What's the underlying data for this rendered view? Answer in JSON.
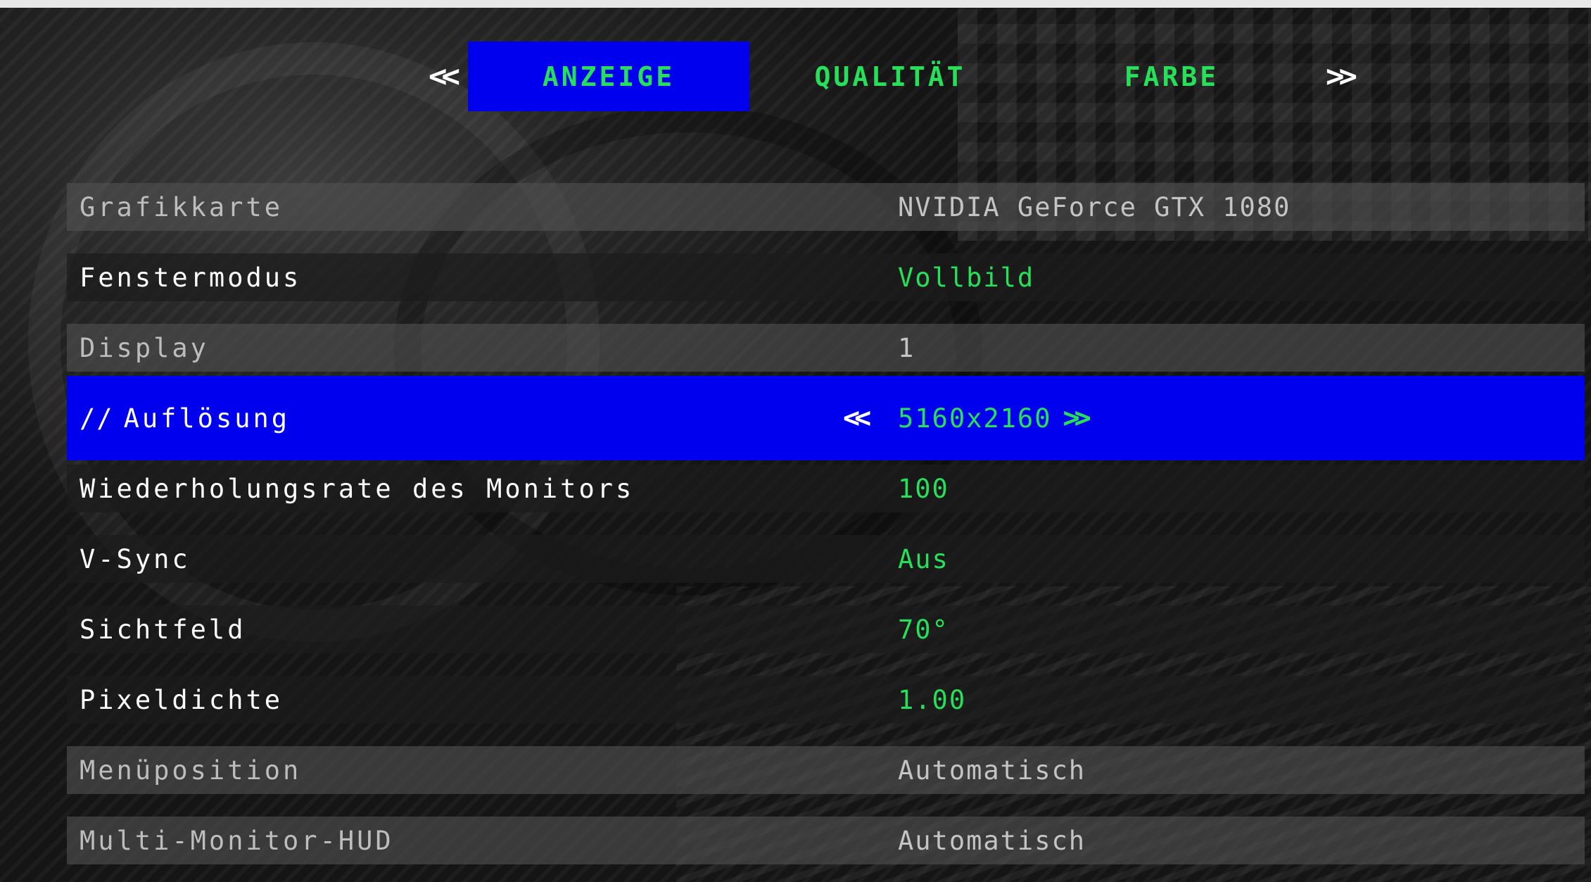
{
  "tabs": {
    "prev_arrow": "<<",
    "next_arrow": ">>",
    "items": [
      {
        "label": "ANZEIGE",
        "active": true
      },
      {
        "label": "QUALITÄT",
        "active": false
      },
      {
        "label": "FARBE",
        "active": false
      }
    ]
  },
  "settings": {
    "selected_prefix": "//",
    "value_prev_arrow": "<<",
    "value_next_arrow": ">>",
    "rows": [
      {
        "label": "Grafikkarte",
        "value": "NVIDIA GeForce GTX 1080",
        "state": "locked"
      },
      {
        "label": "Fenstermodus",
        "value": "Vollbild",
        "state": "editable"
      },
      {
        "label": "Display",
        "value": "1",
        "state": "locked"
      },
      {
        "label": "Auflösung",
        "value": "5160x2160",
        "state": "selected"
      },
      {
        "label": "Wiederholungsrate des Monitors",
        "value": "100",
        "state": "editable"
      },
      {
        "label": "V-Sync",
        "value": "Aus",
        "state": "editable"
      },
      {
        "label": "Sichtfeld",
        "value": "70°",
        "state": "editable"
      },
      {
        "label": "Pixeldichte",
        "value": "1.00",
        "state": "editable"
      },
      {
        "label": "Menüposition",
        "value": "Automatisch",
        "state": "locked"
      },
      {
        "label": "Multi-Monitor-HUD",
        "value": "Automatisch",
        "state": "locked"
      }
    ]
  },
  "colors": {
    "accent_blue": "#0000ee",
    "value_green": "#27e05a",
    "locked_text": "#bdbdbd"
  }
}
